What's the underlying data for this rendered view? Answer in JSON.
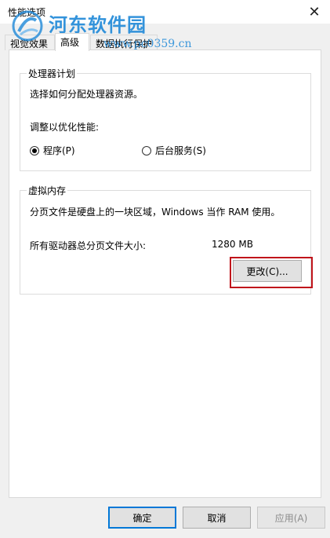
{
  "window": {
    "title": "性能选项"
  },
  "watermark": {
    "name": "河东软件园",
    "url": "www.pc0359.cn"
  },
  "tabs": [
    {
      "label": "视觉效果"
    },
    {
      "label": "高级"
    },
    {
      "label": "数据执行保护"
    }
  ],
  "processor": {
    "group_title": "处理器计划",
    "description": "选择如何分配处理器资源。",
    "adjust_label": "调整以优化性能:",
    "options": [
      {
        "label": "程序(P)",
        "checked": true
      },
      {
        "label": "后台服务(S)",
        "checked": false
      }
    ]
  },
  "virtual_memory": {
    "group_title": "虚拟内存",
    "description": "分页文件是硬盘上的一块区域，Windows 当作 RAM 使用。",
    "total_label": "所有驱动器总分页文件大小:",
    "total_value": "1280 MB",
    "change_button": "更改(C)..."
  },
  "footer": {
    "ok": "确定",
    "cancel": "取消",
    "apply": "应用(A)"
  },
  "colors": {
    "highlight": "#c0141b",
    "default_button_border": "#0078d7",
    "watermark": "#1e88d8"
  }
}
